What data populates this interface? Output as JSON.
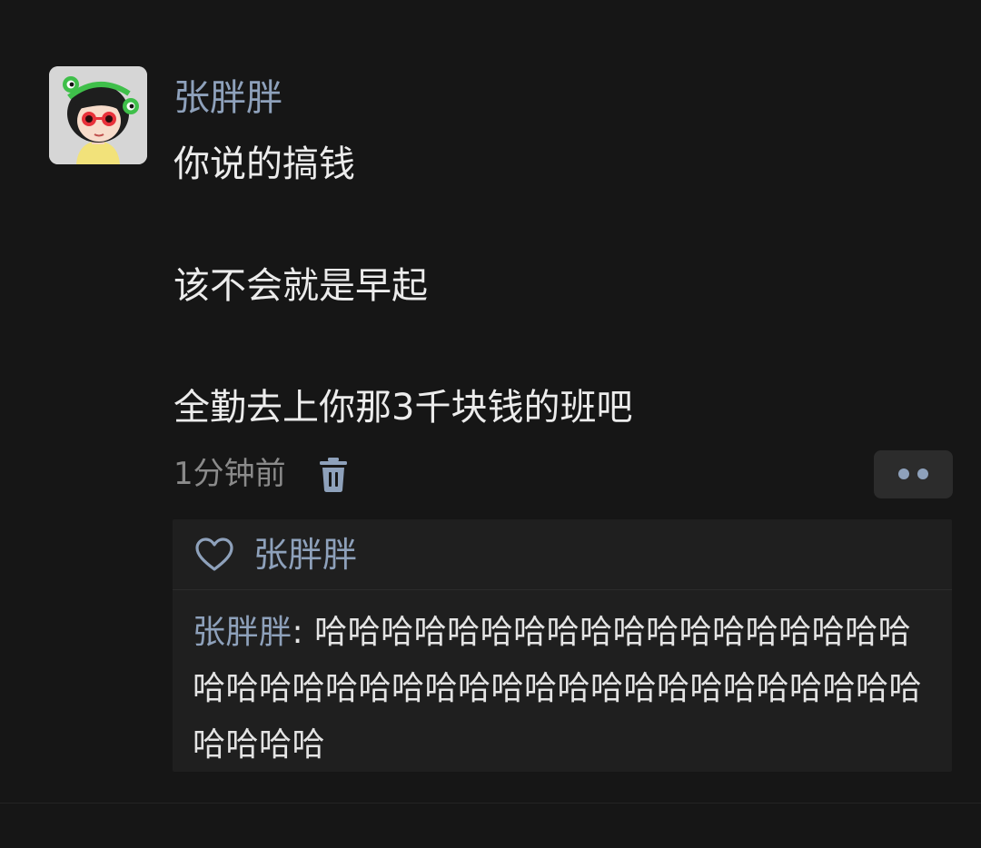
{
  "post": {
    "author": "张胖胖",
    "avatar_icon": "cartoon-girl-frog-hat-avatar",
    "lines": [
      "你说的搞钱",
      "该不会就是早起",
      "全勤去上你那3千块钱的班吧"
    ],
    "time": "1分钟前",
    "delete_icon": "trash-icon",
    "more_icon": "two-dots-icon"
  },
  "interactions": {
    "like_icon": "heart-outline-icon",
    "liker": "张胖胖",
    "comments": [
      {
        "author": "张胖胖",
        "separator": ": ",
        "text": "哈哈哈哈哈哈哈哈哈哈哈哈哈哈哈哈哈哈哈哈哈哈哈哈哈哈哈哈哈哈哈哈哈哈哈哈哈哈哈哈哈哈哈哈"
      }
    ]
  },
  "colors": {
    "background": "#161616",
    "link_blue": "#8ea1bb",
    "text": "#ececec",
    "muted": "#8a8a8a",
    "panel": "#1f1f1f"
  }
}
